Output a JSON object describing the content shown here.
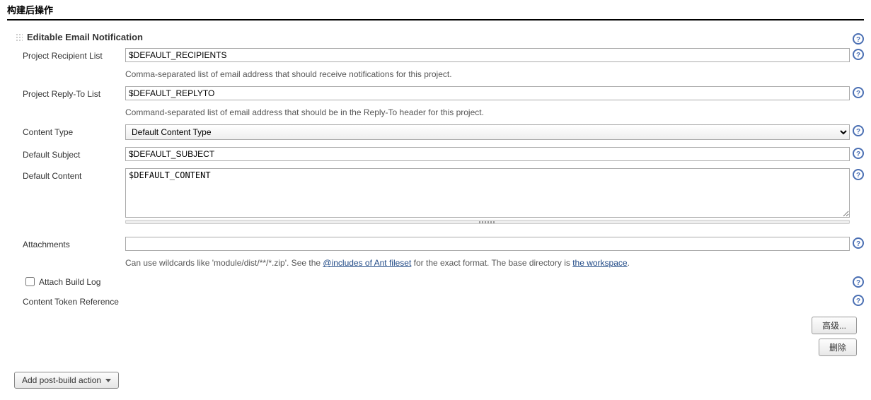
{
  "section": {
    "title": "构建后操作"
  },
  "block": {
    "title": "Editable Email Notification"
  },
  "fields": {
    "recipientList": {
      "label": "Project Recipient List",
      "value": "$DEFAULT_RECIPIENTS",
      "desc": "Comma-separated list of email address that should receive notifications for this project."
    },
    "replyToList": {
      "label": "Project Reply-To List",
      "value": "$DEFAULT_REPLYTO",
      "desc": "Command-separated list of email address that should be in the Reply-To header for this project."
    },
    "contentType": {
      "label": "Content Type",
      "selected": "Default Content Type"
    },
    "defaultSubject": {
      "label": "Default Subject",
      "value": "$DEFAULT_SUBJECT"
    },
    "defaultContent": {
      "label": "Default Content",
      "value": "$DEFAULT_CONTENT"
    },
    "attachments": {
      "label": "Attachments",
      "value": "",
      "descPrefix": "Can use wildcards like 'module/dist/**/*.zip'. See the ",
      "link1": "@includes of Ant fileset",
      "descMiddle": " for the exact format. The base directory is ",
      "link2": "the workspace",
      "descSuffix": "."
    },
    "attachBuildLog": {
      "label": "Attach Build Log",
      "checked": false
    },
    "tokenRef": {
      "label": "Content Token Reference"
    }
  },
  "buttons": {
    "advanced": "高级...",
    "delete": "删除",
    "addAction": "Add post-build action"
  }
}
